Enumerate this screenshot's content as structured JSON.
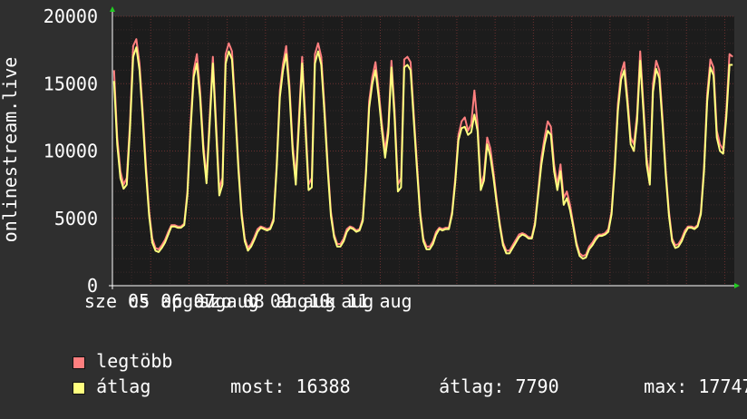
{
  "chart_data": {
    "type": "line",
    "ylabel": "onlinestream.live",
    "ylim": [
      0,
      20000
    ],
    "yticks": [
      0,
      5000,
      10000,
      15000,
      20000
    ],
    "xticks": [
      "sze 05 aug",
      "cs 06 aug",
      "p 07 aug",
      "szo 08 aug",
      "v 09 aug",
      "h 10 aug",
      "k 11 aug"
    ],
    "x_start": "sze 05 aug",
    "x_interval_hours": 2,
    "grid": true,
    "series": [
      {
        "name": "legtöbb",
        "color": "#ff7f7f",
        "values": [
          16000,
          11000,
          8500,
          7500,
          8000,
          12000,
          17800,
          18300,
          16500,
          13000,
          9000,
          5500,
          3500,
          2800,
          2700,
          3000,
          3400,
          4000,
          4500,
          4500,
          4400,
          4400,
          4600,
          7000,
          12000,
          16000,
          17200,
          14500,
          10500,
          8000,
          12500,
          17000,
          12200,
          7200,
          8000,
          17200,
          18000,
          17400,
          13500,
          9000,
          5500,
          3500,
          2800,
          3100,
          3600,
          4200,
          4400,
          4300,
          4200,
          4300,
          5000,
          9000,
          14500,
          16500,
          17800,
          15000,
          10500,
          8000,
          12600,
          17000,
          12500,
          7500,
          8000,
          17200,
          18000,
          17000,
          13300,
          9000,
          5500,
          3800,
          3100,
          3100,
          3500,
          4200,
          4400,
          4300,
          4100,
          4200,
          5000,
          8600,
          13700,
          15500,
          16600,
          14500,
          12000,
          10000,
          11800,
          16700,
          13000,
          7500,
          8000,
          16800,
          17000,
          16600,
          12800,
          9000,
          5500,
          3500,
          2900,
          2900,
          3300,
          4000,
          4300,
          4200,
          4300,
          4300,
          5500,
          8000,
          11200,
          12200,
          12500,
          11500,
          12000,
          14500,
          12000,
          7500,
          8200,
          11000,
          10200,
          8400,
          6400,
          4600,
          3200,
          2600,
          2600,
          3000,
          3400,
          3800,
          3900,
          3800,
          3600,
          3600,
          4700,
          7000,
          9500,
          11000,
          12200,
          11800,
          9000,
          7500,
          9000,
          6500,
          7000,
          6000,
          4600,
          3200,
          2400,
          2200,
          2300,
          2900,
          3200,
          3600,
          3800,
          3800,
          3900,
          4200,
          5500,
          9000,
          13500,
          15800,
          16600,
          14000,
          11000,
          10500,
          12700,
          17400,
          13500,
          9500,
          8000,
          15000,
          16700,
          16000,
          12500,
          8500,
          5500,
          3500,
          3000,
          3100,
          3500,
          4100,
          4400,
          4400,
          4300,
          4500,
          5500,
          8800,
          14200,
          16800,
          16200,
          11500,
          10500,
          10100,
          13000,
          17200,
          17000
        ]
      },
      {
        "name": "átlag",
        "color": "#ffff7f",
        "values": [
          15200,
          10500,
          8000,
          7200,
          7500,
          11500,
          17000,
          17700,
          16000,
          12500,
          8500,
          5200,
          3200,
          2600,
          2500,
          2800,
          3200,
          3800,
          4400,
          4400,
          4300,
          4300,
          4500,
          6700,
          11500,
          15500,
          16500,
          14000,
          10000,
          7600,
          12000,
          16500,
          11600,
          6700,
          7500,
          16500,
          17400,
          16800,
          13000,
          8600,
          5200,
          3300,
          2600,
          2900,
          3400,
          4000,
          4300,
          4200,
          4100,
          4200,
          4800,
          8700,
          14000,
          16000,
          17200,
          14500,
          10000,
          7500,
          12000,
          16500,
          11800,
          7100,
          7300,
          16500,
          17400,
          16400,
          12800,
          8600,
          5200,
          3600,
          2900,
          2900,
          3300,
          4000,
          4300,
          4200,
          4000,
          4100,
          4800,
          8300,
          13200,
          15000,
          16000,
          14000,
          11500,
          9500,
          11300,
          16200,
          12400,
          7000,
          7300,
          16200,
          16400,
          16000,
          12300,
          8600,
          5200,
          3300,
          2700,
          2700,
          3100,
          3800,
          4200,
          4100,
          4200,
          4200,
          5300,
          7700,
          10800,
          11700,
          11800,
          11200,
          11400,
          12700,
          11500,
          7100,
          7800,
          10500,
          9600,
          8000,
          6100,
          4400,
          3000,
          2400,
          2400,
          2800,
          3200,
          3600,
          3800,
          3700,
          3500,
          3500,
          4500,
          6700,
          9000,
          10500,
          11500,
          11200,
          8500,
          7100,
          8500,
          6000,
          6500,
          5600,
          4400,
          3000,
          2200,
          2000,
          2100,
          2700,
          3000,
          3400,
          3700,
          3700,
          3800,
          4000,
          5300,
          8600,
          13000,
          15300,
          16000,
          13500,
          10500,
          10000,
          12200,
          16700,
          13000,
          9000,
          7500,
          14400,
          16100,
          15400,
          12000,
          8200,
          5200,
          3300,
          2800,
          2900,
          3300,
          3900,
          4300,
          4300,
          4200,
          4400,
          5300,
          8500,
          13700,
          16200,
          15600,
          11000,
          10000,
          9800,
          12500,
          16400,
          16400
        ]
      }
    ],
    "summary": {
      "now_label": "most:",
      "now_value": "16388",
      "avg_label": "átlag:",
      "avg_value": "7790",
      "max_label": "max:",
      "max_value": "17747"
    }
  }
}
